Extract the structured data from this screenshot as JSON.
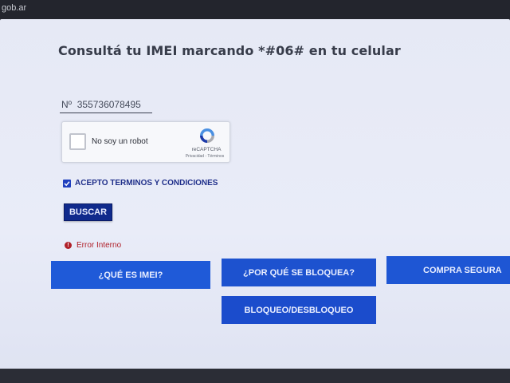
{
  "browser": {
    "url_fragment": "gob.ar"
  },
  "page": {
    "title": "Consultá tu IMEI marcando *#06# en tu celular",
    "imei_input": {
      "value": "Nº  355736078495",
      "placeholder": "Nº"
    }
  },
  "captcha": {
    "label": "No soy un robot",
    "brand": "reCAPTCHA",
    "links": "Privacidad - Términos",
    "icon": "recaptcha-icon"
  },
  "terms": {
    "checked": true,
    "label": "ACEPTO TERMINOS Y CONDICIONES"
  },
  "search_button": {
    "label": "BUSCAR"
  },
  "error": {
    "icon": "error-icon",
    "message": "Error Interno"
  },
  "nav_buttons": [
    {
      "label": "¿QUÉ ES IMEI?"
    },
    {
      "label": "¿POR QUÉ SE BLOQUEA?"
    },
    {
      "label": "COMPRA SEGURA"
    },
    {
      "label": "BLOQUEO/DESBLOQUEO"
    }
  ],
  "colors": {
    "primary_blue": "#1d52cf",
    "dark_blue": "#102a8c",
    "error_red": "#b0202a",
    "page_bg": "#e6e9f5"
  }
}
